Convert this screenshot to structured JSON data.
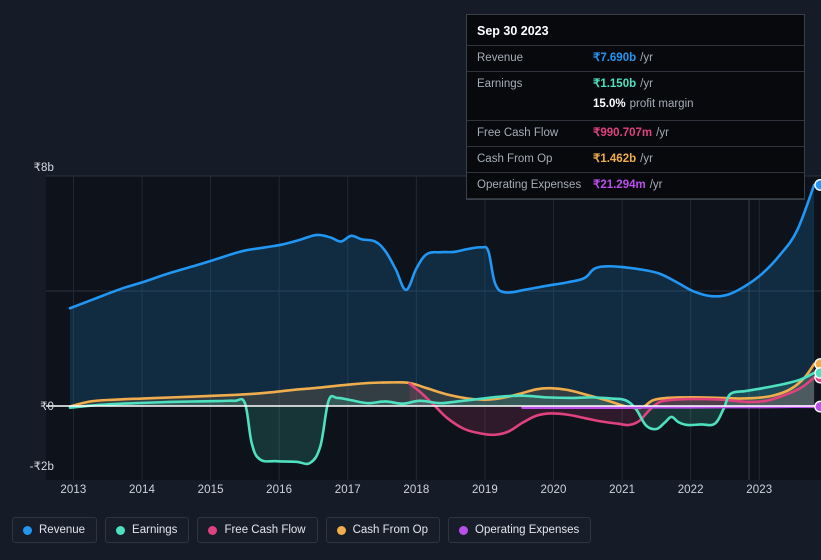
{
  "theme": {
    "background": "#151c27",
    "plot_background": "#0d121b",
    "grid_color": "#2b3442",
    "zero_line_color": "#ffffff",
    "axis_text_color": "#d6dae1"
  },
  "axes": {
    "y_ticks": [
      {
        "label": "₹8b",
        "value": 8
      },
      {
        "label": "₹0",
        "value": 0
      },
      {
        "label": "-₹2b",
        "value": -2
      }
    ],
    "x_ticks": [
      "2013",
      "2014",
      "2015",
      "2016",
      "2017",
      "2018",
      "2019",
      "2020",
      "2021",
      "2022",
      "2023"
    ],
    "ylim": [
      -2.5,
      8.6
    ],
    "currency": "₹"
  },
  "tooltip": {
    "date": "Sep 30 2023",
    "rows": [
      {
        "name": "Revenue",
        "value": "₹7.690b",
        "unit": "/yr",
        "color": "#2196f3"
      },
      {
        "name": "Earnings",
        "value": "₹1.150b",
        "unit": "/yr",
        "color": "#4fe0c0"
      },
      {
        "name": "Free Cash Flow",
        "value": "₹990.707m",
        "unit": "/yr",
        "color": "#e0427f"
      },
      {
        "name": "Cash From Op",
        "value": "₹1.462b",
        "unit": "/yr",
        "color": "#f0ad4e"
      },
      {
        "name": "Operating Expenses",
        "value": "₹21.294m",
        "unit": "/yr",
        "color": "#b94ee8"
      }
    ],
    "profit_margin": {
      "value": "15.0%",
      "label": "profit margin"
    }
  },
  "legend": {
    "items": [
      {
        "label": "Revenue",
        "color": "#2196f3"
      },
      {
        "label": "Earnings",
        "color": "#4fe0c0"
      },
      {
        "label": "Free Cash Flow",
        "color": "#e0427f"
      },
      {
        "label": "Cash From Op",
        "color": "#f0ad4e"
      },
      {
        "label": "Operating Expenses",
        "color": "#b94ee8"
      }
    ]
  },
  "chart_data": {
    "type": "area",
    "title": "",
    "xlabel": "",
    "ylabel": "",
    "ylim": [
      -2.5,
      8.6
    ],
    "xlim": [
      2012.6,
      2023.9
    ],
    "grid": true,
    "legend_position": "bottom",
    "currency_unit": "billions of ₹ per year",
    "forecast_divider_x": 2022.85,
    "series": [
      {
        "name": "Revenue",
        "color": "#2196f3",
        "fill": "rgba(33,130,200,0.22)",
        "end_marker": true,
        "points": [
          [
            2012.95,
            3.4
          ],
          [
            2013.3,
            3.72
          ],
          [
            2013.7,
            4.08
          ],
          [
            2014.0,
            4.3
          ],
          [
            2014.4,
            4.62
          ],
          [
            2014.8,
            4.9
          ],
          [
            2015.1,
            5.12
          ],
          [
            2015.45,
            5.38
          ],
          [
            2015.8,
            5.52
          ],
          [
            2016.05,
            5.62
          ],
          [
            2016.3,
            5.78
          ],
          [
            2016.55,
            5.95
          ],
          [
            2016.75,
            5.86
          ],
          [
            2016.9,
            5.72
          ],
          [
            2017.05,
            5.92
          ],
          [
            2017.2,
            5.8
          ],
          [
            2017.4,
            5.72
          ],
          [
            2017.55,
            5.38
          ],
          [
            2017.7,
            4.75
          ],
          [
            2017.85,
            4.04
          ],
          [
            2018.0,
            4.78
          ],
          [
            2018.15,
            5.28
          ],
          [
            2018.35,
            5.35
          ],
          [
            2018.55,
            5.36
          ],
          [
            2018.75,
            5.46
          ],
          [
            2018.95,
            5.52
          ],
          [
            2019.05,
            5.38
          ],
          [
            2019.15,
            4.25
          ],
          [
            2019.3,
            3.95
          ],
          [
            2019.6,
            4.05
          ],
          [
            2019.9,
            4.18
          ],
          [
            2020.2,
            4.3
          ],
          [
            2020.45,
            4.45
          ],
          [
            2020.6,
            4.78
          ],
          [
            2020.8,
            4.86
          ],
          [
            2021.05,
            4.82
          ],
          [
            2021.3,
            4.74
          ],
          [
            2021.55,
            4.6
          ],
          [
            2021.8,
            4.3
          ],
          [
            2022.05,
            3.98
          ],
          [
            2022.3,
            3.82
          ],
          [
            2022.55,
            3.88
          ],
          [
            2022.8,
            4.18
          ],
          [
            2023.05,
            4.62
          ],
          [
            2023.3,
            5.25
          ],
          [
            2023.55,
            6.1
          ],
          [
            2023.8,
            7.69
          ]
        ]
      },
      {
        "name": "Earnings",
        "color": "#4fe0c0",
        "fill": "rgba(79,224,192,0.17)",
        "end_marker": true,
        "points": [
          [
            2012.95,
            -0.06
          ],
          [
            2013.4,
            0.04
          ],
          [
            2013.9,
            0.1
          ],
          [
            2014.4,
            0.14
          ],
          [
            2014.8,
            0.16
          ],
          [
            2015.1,
            0.17
          ],
          [
            2015.35,
            0.18
          ],
          [
            2015.5,
            0.1
          ],
          [
            2015.6,
            -1.3
          ],
          [
            2015.72,
            -1.86
          ],
          [
            2015.95,
            -1.92
          ],
          [
            2016.25,
            -1.94
          ],
          [
            2016.45,
            -1.98
          ],
          [
            2016.6,
            -1.4
          ],
          [
            2016.72,
            0.18
          ],
          [
            2016.85,
            0.28
          ],
          [
            2017.05,
            0.2
          ],
          [
            2017.3,
            0.1
          ],
          [
            2017.55,
            0.16
          ],
          [
            2017.8,
            0.08
          ],
          [
            2018.05,
            0.18
          ],
          [
            2018.35,
            0.1
          ],
          [
            2018.6,
            0.16
          ],
          [
            2018.9,
            0.24
          ],
          [
            2019.2,
            0.32
          ],
          [
            2019.55,
            0.36
          ],
          [
            2019.9,
            0.3
          ],
          [
            2020.25,
            0.28
          ],
          [
            2020.55,
            0.3
          ],
          [
            2020.85,
            0.26
          ],
          [
            2021.05,
            0.2
          ],
          [
            2021.2,
            -0.1
          ],
          [
            2021.35,
            -0.68
          ],
          [
            2021.5,
            -0.8
          ],
          [
            2021.62,
            -0.58
          ],
          [
            2021.72,
            -0.38
          ],
          [
            2021.82,
            -0.56
          ],
          [
            2021.95,
            -0.66
          ],
          [
            2022.15,
            -0.64
          ],
          [
            2022.35,
            -0.62
          ],
          [
            2022.48,
            -0.1
          ],
          [
            2022.58,
            0.42
          ],
          [
            2022.8,
            0.52
          ],
          [
            2023.05,
            0.62
          ],
          [
            2023.35,
            0.76
          ],
          [
            2023.6,
            0.92
          ],
          [
            2023.8,
            1.15
          ]
        ]
      },
      {
        "name": "Free Cash Flow",
        "color": "#e0427f",
        "fill": "rgba(224,66,127,0.16)",
        "end_marker": true,
        "start_x": 2017.9,
        "points": [
          [
            2017.9,
            0.78
          ],
          [
            2018.05,
            0.5
          ],
          [
            2018.25,
            0.05
          ],
          [
            2018.45,
            -0.42
          ],
          [
            2018.7,
            -0.8
          ],
          [
            2018.95,
            -0.96
          ],
          [
            2019.15,
            -1.0
          ],
          [
            2019.35,
            -0.88
          ],
          [
            2019.55,
            -0.58
          ],
          [
            2019.75,
            -0.34
          ],
          [
            2019.95,
            -0.26
          ],
          [
            2020.2,
            -0.3
          ],
          [
            2020.45,
            -0.42
          ],
          [
            2020.7,
            -0.54
          ],
          [
            2020.95,
            -0.62
          ],
          [
            2021.1,
            -0.66
          ],
          [
            2021.25,
            -0.52
          ],
          [
            2021.4,
            -0.14
          ],
          [
            2021.55,
            0.14
          ],
          [
            2021.75,
            0.22
          ],
          [
            2021.95,
            0.24
          ],
          [
            2022.2,
            0.24
          ],
          [
            2022.45,
            0.22
          ],
          [
            2022.65,
            0.18
          ],
          [
            2022.85,
            0.14
          ],
          [
            2023.1,
            0.18
          ],
          [
            2023.35,
            0.36
          ],
          [
            2023.6,
            0.62
          ],
          [
            2023.8,
            0.99
          ]
        ]
      },
      {
        "name": "Cash From Op",
        "color": "#f0ad4e",
        "fill": "rgba(240,173,78,0.15)",
        "end_marker": true,
        "points": [
          [
            2012.95,
            -0.02
          ],
          [
            2013.25,
            0.16
          ],
          [
            2013.6,
            0.22
          ],
          [
            2014.0,
            0.26
          ],
          [
            2014.45,
            0.3
          ],
          [
            2014.9,
            0.34
          ],
          [
            2015.3,
            0.38
          ],
          [
            2015.6,
            0.42
          ],
          [
            2015.9,
            0.48
          ],
          [
            2016.2,
            0.56
          ],
          [
            2016.5,
            0.62
          ],
          [
            2016.75,
            0.68
          ],
          [
            2017.0,
            0.74
          ],
          [
            2017.3,
            0.8
          ],
          [
            2017.6,
            0.82
          ],
          [
            2017.9,
            0.8
          ],
          [
            2018.15,
            0.62
          ],
          [
            2018.45,
            0.4
          ],
          [
            2018.75,
            0.26
          ],
          [
            2019.0,
            0.22
          ],
          [
            2019.25,
            0.28
          ],
          [
            2019.5,
            0.42
          ],
          [
            2019.75,
            0.58
          ],
          [
            2019.95,
            0.62
          ],
          [
            2020.2,
            0.56
          ],
          [
            2020.5,
            0.38
          ],
          [
            2020.8,
            0.18
          ],
          [
            2021.0,
            0.02
          ],
          [
            2021.15,
            -0.06
          ],
          [
            2021.3,
            -0.04
          ],
          [
            2021.45,
            0.2
          ],
          [
            2021.65,
            0.28
          ],
          [
            2021.9,
            0.3
          ],
          [
            2022.15,
            0.3
          ],
          [
            2022.45,
            0.28
          ],
          [
            2022.7,
            0.26
          ],
          [
            2022.95,
            0.28
          ],
          [
            2023.2,
            0.36
          ],
          [
            2023.45,
            0.58
          ],
          [
            2023.65,
            0.96
          ],
          [
            2023.8,
            1.46
          ]
        ]
      },
      {
        "name": "Operating Expenses",
        "color": "#b94ee8",
        "fill": "rgba(185,78,232,0.10)",
        "end_marker": true,
        "start_x": 2019.55,
        "points": [
          [
            2019.55,
            -0.05
          ],
          [
            2020.0,
            -0.05
          ],
          [
            2020.5,
            -0.05
          ],
          [
            2021.0,
            -0.05
          ],
          [
            2021.5,
            -0.04
          ],
          [
            2022.0,
            -0.04
          ],
          [
            2022.5,
            -0.03
          ],
          [
            2023.0,
            -0.03
          ],
          [
            2023.4,
            -0.02
          ],
          [
            2023.8,
            -0.02
          ]
        ]
      }
    ]
  }
}
